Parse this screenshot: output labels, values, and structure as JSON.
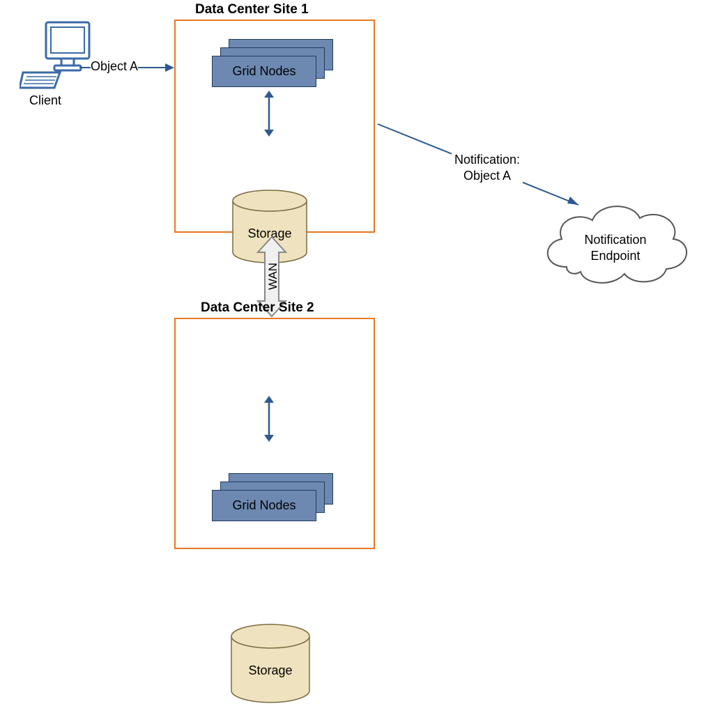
{
  "client": {
    "label": "Client"
  },
  "object_a": {
    "label": "Object A"
  },
  "site1": {
    "title": "Data Center Site 1",
    "grid_nodes_label": "Grid Nodes",
    "storage_label": "Storage"
  },
  "site2": {
    "title": "Data Center Site 2",
    "grid_nodes_label": "Grid Nodes",
    "storage_label": "Storage"
  },
  "wan": {
    "label": "WAN"
  },
  "notification": {
    "line1": "Notification:",
    "line2": "Object A"
  },
  "endpoint": {
    "line1": "Notification",
    "line2": "Endpoint"
  },
  "colors": {
    "orange": "#e87722",
    "node_fill": "#6d89b1",
    "node_border": "#1f3a5f",
    "storage_fill": "#efe2be",
    "storage_border": "#7a6b3f",
    "arrow_blue": "#2d5a8f",
    "client_blue": "#3a6aa8"
  }
}
